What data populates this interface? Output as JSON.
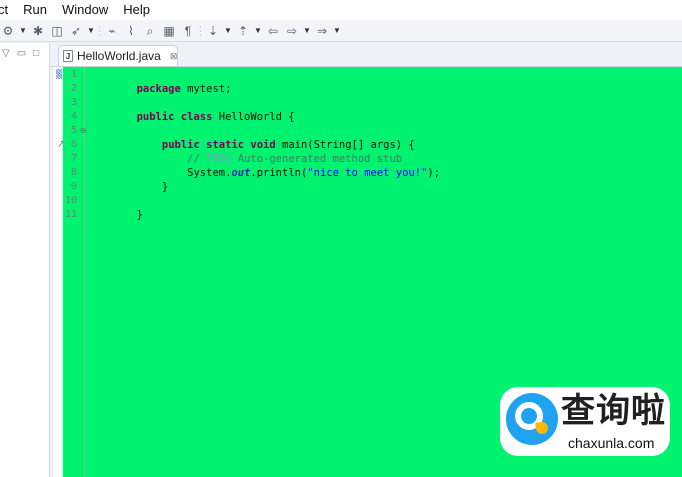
{
  "menu": [
    {
      "label": "ct"
    },
    {
      "label": "Run"
    },
    {
      "label": "Window"
    },
    {
      "label": "Help"
    }
  ],
  "toolbar": {
    "icons": [
      "new-java-project-icon",
      "dropdown-arrow-icon",
      "new-package-icon",
      "new-class-icon",
      "new-interface-icon",
      "dropdown-arrow-icon",
      "toolbar-separator-icon",
      "open-type-icon",
      "open-type-hierarchy-icon",
      "search-icon",
      "annotation-icon",
      "paragraph-icon",
      "toolbar-separator-icon",
      "next-annotation-icon",
      "dropdown-arrow-icon",
      "previous-annotation-icon",
      "dropdown-arrow-icon",
      "back-icon",
      "forward-icon",
      "dropdown-arrow-icon",
      "next-edit-icon",
      "dropdown-arrow-icon"
    ]
  },
  "editor": {
    "tab": {
      "title": "HelloWorld.java",
      "icon": "java-file-icon",
      "close_label": "⊠"
    },
    "line_numbers": [
      "1",
      "2",
      "3",
      "4",
      "5",
      "6",
      "7",
      "8",
      "9",
      "10",
      "11"
    ],
    "code": [
      {
        "prefix": "",
        "keyword": "package",
        "text": " mytest;"
      },
      {
        "prefix": "",
        "keyword": "",
        "text": ""
      },
      {
        "prefix": "",
        "keyword": "public class",
        "text": " HelloWorld {"
      },
      {
        "prefix": "",
        "keyword": "",
        "text": ""
      },
      {
        "prefix": "    ",
        "keyword": "public static void",
        "text": " main(String[] args) {"
      },
      {
        "prefix": "        ",
        "comment": "// ",
        "todo": "TODO",
        "comment_tail": " Auto-generated method stub"
      },
      {
        "prefix": "        ",
        "text": "System.",
        "field": "out",
        "text2": ".println(",
        "string": "\"nice to meet you!\"",
        "text3": ");"
      },
      {
        "prefix": "    ",
        "keyword": "",
        "text": "}"
      },
      {
        "prefix": "",
        "keyword": "",
        "text": ""
      },
      {
        "prefix": "",
        "keyword": "",
        "text": "}"
      },
      {
        "prefix": "",
        "keyword": "",
        "text": ""
      }
    ],
    "fold_markers": [
      "⊖"
    ],
    "override_icon": "override-marker-icon"
  },
  "left_panel": {
    "controls": [
      "view-menu-icon",
      "minimize-icon",
      "maximize-icon"
    ],
    "control_glyphs": [
      "▽",
      "▭",
      "□"
    ]
  },
  "watermark": {
    "title": "查询啦",
    "domain": "chaxunla.com",
    "accent": "#1fa3f0",
    "highlight": "#ffb800"
  },
  "colors": {
    "editor_background": "#00f36f",
    "keyword": "#7f0055",
    "comment": "#3f7f5f",
    "todo": "#7f9fbf",
    "string": "#1a00ff",
    "field": "#1b2ea8"
  }
}
